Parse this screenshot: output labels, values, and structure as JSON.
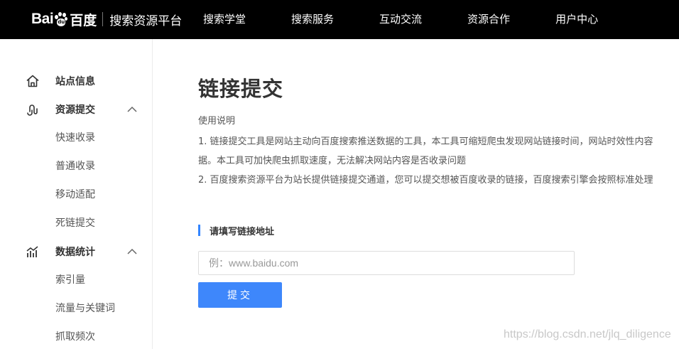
{
  "header": {
    "logo": {
      "bai": "Bai",
      "paw_text": "du",
      "cn": "百度",
      "subtitle": "搜索资源平台"
    },
    "nav": [
      "搜索学堂",
      "搜索服务",
      "互动交流",
      "资源合作",
      "用户中心"
    ]
  },
  "sidebar": {
    "site_info": "站点信息",
    "resource_submit": {
      "label": "资源提交",
      "items": [
        "快速收录",
        "普通收录",
        "移动适配",
        "死链提交"
      ]
    },
    "data_stats": {
      "label": "数据统计",
      "items": [
        "索引量",
        "流量与关键词",
        "抓取频次"
      ]
    }
  },
  "main": {
    "title": "链接提交",
    "usage_title": "使用说明",
    "usage_lines": [
      "1. 链接提交工具是网站主动向百度搜索推送数据的工具，本工具可缩短爬虫发现网站链接时间，网站时效性内容",
      "据。本工具可加快爬虫抓取速度，无法解决网站内容是否收录问题",
      "2. 百度搜索资源平台为站长提供链接提交通道，您可以提交想被百度收录的链接，百度搜索引擎会按照标准处理"
    ],
    "section_label": "请填写链接地址",
    "input": {
      "value": "",
      "placeholder": "例：www.baidu.com"
    },
    "submit_label": "提交"
  },
  "watermark": "https://blog.csdn.net/jlq_diligence",
  "colors": {
    "accent": "#3e87fb",
    "header_bg": "#000000"
  }
}
